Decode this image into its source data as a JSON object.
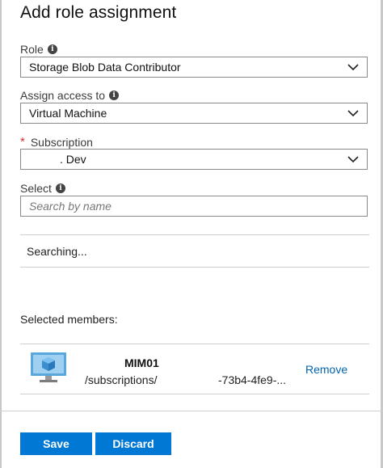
{
  "panel": {
    "title": "Add role assignment"
  },
  "role": {
    "label": "Role",
    "value": "Storage Blob Data Contributor"
  },
  "assign_access": {
    "label": "Assign access to",
    "value": "Virtual Machine"
  },
  "subscription": {
    "required_mark": "*",
    "label": "Subscription",
    "value": ". Dev"
  },
  "select": {
    "label": "Select",
    "placeholder": "Search by name"
  },
  "status": {
    "searching": "Searching..."
  },
  "selected_members": {
    "title": "Selected members:",
    "items": [
      {
        "name": "MIM01",
        "path": "/subscriptions/",
        "id": "-73b4-4fe9-...",
        "remove_label": "Remove",
        "icon": "virtual-machine-icon"
      }
    ]
  },
  "footer": {
    "save_label": "Save",
    "discard_label": "Discard"
  },
  "colors": {
    "accent": "#0078d4",
    "link": "#0063b1",
    "required": "#d13438"
  }
}
